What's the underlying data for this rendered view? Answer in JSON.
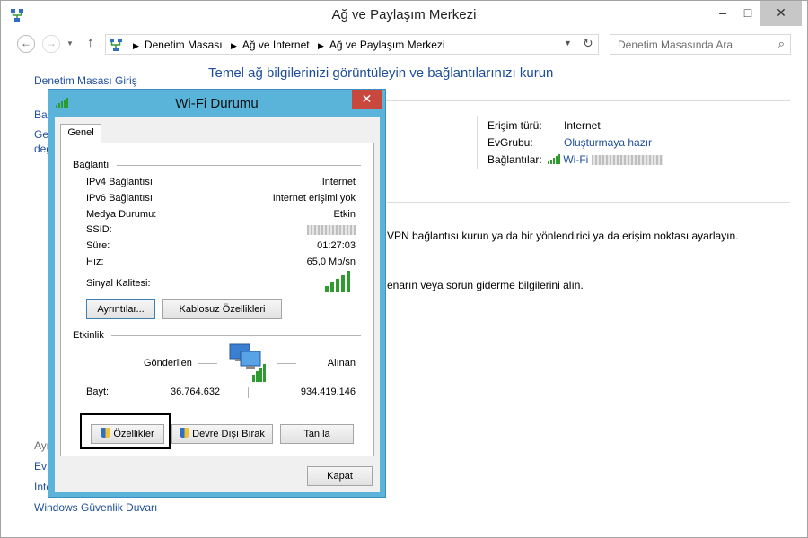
{
  "window": {
    "title": "Ağ ve Paylaşım Merkezi",
    "controls": {
      "minimize": "–",
      "maximize": "□",
      "close": "✕"
    }
  },
  "nav": {
    "breadcrumbs": [
      "Denetim Masası",
      "Ağ ve Internet",
      "Ağ ve Paylaşım Merkezi"
    ],
    "search_placeholder": "Denetim Masasında Ara"
  },
  "main": {
    "heading": "Temel ağ bilgilerinizi görüntüleyin ve bağlantılarınızı kurun",
    "sidebar": {
      "home": "Denetim Masası Giriş",
      "partial_1": "Bağ",
      "partial_2": "Gel",
      "partial_3": "değ",
      "see_also_partial": "Ayr",
      "partial_4": "Ev",
      "partial_5": "Inte",
      "firewall": "Windows Güvenlik Duvarı"
    },
    "network_info": {
      "access_type_label": "Erişim türü:",
      "access_type_value": "Internet",
      "homegroup_label": "EvGrubu:",
      "homegroup_value": "Oluşturmaya hazır",
      "connections_label": "Bağlantılar:",
      "connections_value": "Wi-Fi"
    },
    "desc_vpn": "VPN bağlantısı kurun ya da bir yönlendirici ya da erişim noktası ayarlayın.",
    "desc_troubleshoot": "enarın veya sorun giderme bilgilerini alın."
  },
  "dialog": {
    "title": "Wi-Fi Durumu",
    "close": "✕",
    "tab": "Genel",
    "connection_group": "Bağlantı",
    "rows": [
      {
        "label": "IPv4 Bağlantısı:",
        "value": "Internet"
      },
      {
        "label": "IPv6 Bağlantısı:",
        "value": "Internet erişimi yok"
      },
      {
        "label": "Medya Durumu:",
        "value": "Etkin"
      },
      {
        "label": "SSID:",
        "value": ""
      },
      {
        "label": "Süre:",
        "value": "01:27:03"
      },
      {
        "label": "Hız:",
        "value": "65,0 Mb/sn"
      }
    ],
    "signal_label": "Sinyal Kalitesi:",
    "signal_bars": 5,
    "details_button": "Ayrıntılar...",
    "wireless_props_button": "Kablosuz Özellikleri",
    "activity_group": "Etkinlik",
    "sent_label": "Gönderilen",
    "received_label": "Alınan",
    "bytes_label": "Bayt:",
    "bytes_sent": "36.764.632",
    "bytes_received": "934.419.146",
    "properties_button": "Özellikler",
    "disable_button": "Devre Dışı Bırak",
    "diagnose_button": "Tanıla",
    "close_button": "Kapat"
  },
  "colors": {
    "accent": "#5ab4da",
    "link": "#1e4e9b",
    "close_red": "#c9483e"
  }
}
